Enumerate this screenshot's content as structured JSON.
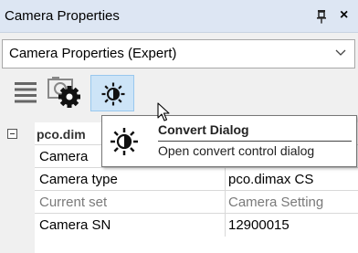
{
  "window": {
    "title": "Camera Properties"
  },
  "icons": {
    "pin": "pin-icon",
    "close": "close-icon",
    "combo_arrow": "chevron-down-icon",
    "list": "list-icon",
    "settings": "camera-settings-icon",
    "convert": "brightness-icon",
    "cursor": "mouse-pointer-icon"
  },
  "window_controls": {
    "close_glyph": "×"
  },
  "mode_select": {
    "value": "Camera Properties (Expert)"
  },
  "property_grid": {
    "category": "pco.dim",
    "rows": [
      {
        "name": "Camera",
        "value": ""
      },
      {
        "name": "Camera type",
        "value": "pco.dimax CS"
      },
      {
        "name": "Current set",
        "value": "Camera Setting"
      },
      {
        "name": "Camera SN",
        "value": "12900015"
      }
    ]
  },
  "tooltip": {
    "title": "Convert Dialog",
    "description": "Open convert control dialog"
  },
  "colors": {
    "titlebar": "#dde6f3",
    "active_button": "#cde4f7",
    "disabled_text": "#7a7a7a"
  }
}
